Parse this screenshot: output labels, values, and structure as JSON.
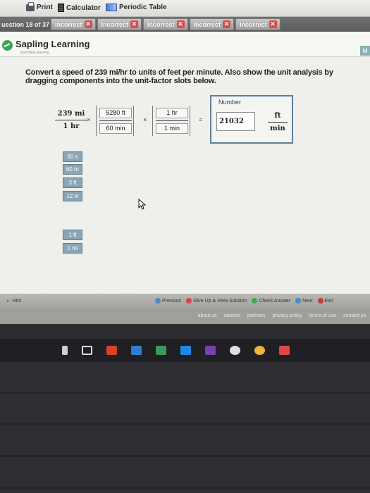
{
  "toolbar": {
    "print": "Print",
    "calculator": "Calculator",
    "periodic_table": "Periodic Table"
  },
  "tabs": {
    "question_label": "uestion 18 of 37",
    "items": [
      "Incorrect",
      "Incorrect",
      "Incorrect",
      "Incorrect",
      "Incorrect"
    ]
  },
  "header": {
    "brand": "Sapling Learning",
    "brand_sub": "macmillan learning",
    "corner": "M"
  },
  "prompt": "Convert a speed of 239 mi/hr to units of feet per minute. Also show the unit analysis by dragging components into the unit-factor slots below.",
  "problem": {
    "given_num": "239  mi",
    "given_den": "1  hr",
    "times": "×",
    "slot1_top": "5280 ft",
    "slot1_bottom": "60 min",
    "slot2_top": "1 hr",
    "slot2_bottom": "1 min",
    "equals": "="
  },
  "answer": {
    "label": "Number",
    "value": "21032",
    "unit_num": "ft",
    "unit_den": "min"
  },
  "tiles": [
    "60 s",
    "60 hr",
    "3 ft",
    "12 in",
    "1 ft",
    "1 mi"
  ],
  "bottom_bar": {
    "hint": "Hint",
    "previous": "Previous",
    "give_up": "Give Up & View Solution",
    "check": "Check Answer",
    "next": "Next",
    "exit": "Exit"
  },
  "footer": [
    "about us",
    "careers",
    "partners",
    "privacy policy",
    "terms of use",
    "contact us"
  ],
  "colors": {
    "tile": "#8aa5b5",
    "incorrect_x": "#e0484a",
    "answer_border": "#5e7f99"
  }
}
